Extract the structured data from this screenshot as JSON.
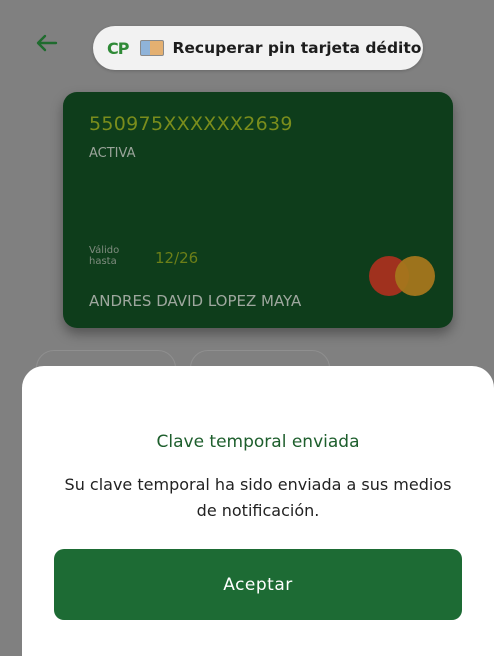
{
  "header": {
    "back_icon": "arrow-left-icon",
    "logo_text": "CP",
    "card_icon": "card-icon",
    "title": "Recuperar pin tarjeta dédito"
  },
  "card": {
    "number": "550975XXXXXX2639",
    "status": "ACTIVA",
    "valid_label": "Válido hasta",
    "valid_date": "12/26",
    "holder": "ANDRES DAVID LOPEZ MAYA",
    "brand_icon": "mastercard-logo-icon"
  },
  "dialog": {
    "title": "Clave temporal enviada",
    "message": "Su clave temporal ha sido enviada a sus medios de notificación.",
    "accept_label": "Aceptar"
  },
  "colors": {
    "primary_green": "#1d6b34",
    "card_bg": "#0e3d1b",
    "overlay": "#808080"
  }
}
